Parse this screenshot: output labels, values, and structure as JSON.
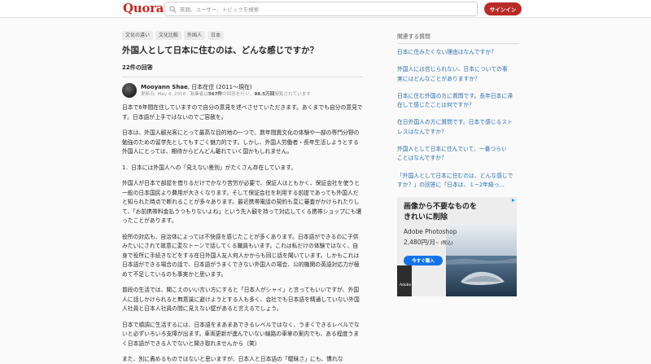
{
  "header": {
    "logo": "Quora",
    "search_placeholder": "質問、ユーザー、トピックを検索",
    "signin_label": "サインイン",
    "brand_color": "#b92b27"
  },
  "question": {
    "tags": [
      "文化の違い",
      "文化比較",
      "外国人",
      "日本"
    ],
    "title": "外国人として日本に住むのは、どんな感じですか？",
    "answer_count": "22件の回答"
  },
  "answer": {
    "author_name": "Mooyann Shae",
    "author_credential": ", 日本在住 (2011〜現在)",
    "meta_prefix": "更新日: May 4, 2018 · 執筆者は",
    "meta_answers": "567件",
    "meta_mid": "の回答を行い、",
    "meta_views": "98.5万回",
    "meta_suffix": "閲覧されています",
    "paragraphs": [
      "日本で6年間在住していますので自分の意見を述べさせていただきます。あくまでも自分の意見です。日本語が上手ではないのでご容赦を。",
      "日本は、外国人観光客にとって最高な目的地の一つで、数年間異文化の体験や一部の専門分野の勉強のための留学先としてもすごく魅力的です。しかし、外国人労働者・長年生活しようとする外国人にとっては、期待からどんどん離れていく国かもしれません。",
      "1．日本には外国人への「見えない差別」がたくさん存在しています。",
      "外国人が日本で部屋を借りるだけでかなり苦労が必要で、保証人はともかく、保証会社を使うと一般の日本国民より費用が大きくなります。そして保証会社を利用する前提であっても外国人だと知られた時点で断れることが多々あります。最近携帯電話の契約も変に審査がかけられたりして、「お前携帯料金払うつもりないよね」という先入観を持って対応してくる携帯ショップにも遭ったことがあります。",
      "役所の対応も、自治体によっては不快感を感じたことが多くあります。日本語ができるのに子供みたいにされて故意に変なトーンで話してくる職員もいます。これは私だけの体験ではなく、自身で役所に手続きなどをする在日外国人友人何人かからも同じ話を聞いています。しかもこれは日本語ができる場合の話で、日本語がうまくできない外国人の場合、公的機関の英語対応力が極めて不足しているのも事実かと思います。",
      "普段の生活では、聞こえのいい言い方にすると「日本人がシャイ」と言ってもいいですが、外国人に話しかけられると無意識に避けようとする人も多く、会社でも日本語を精通していない外国人社員と日本人社員の間に見えない壁があると言えるでしょう。",
      "日本で順調に生活するには、日本語をまあまあできるレベルではなく、うまくできるレベルでないと必ずいろいろ支障が出ます。車両更新が進んでいない線路の車掌の案内でも、ある程度うまく日本語ができる人でないと聞き取れませんから（笑）",
      "また、別に責めるものではないと思いますが、日本人と日本語の「曖昧さ」にも、慣れな"
    ]
  },
  "sidebar": {
    "title": "関連する質問",
    "link_color": "#2b6dad",
    "questions": [
      "日本に住みたくない理由はなんですか？",
      "外国人には信じられない、日本についての事\n実にはどんなことがありますか？",
      "日本に住む外国の方に質問です。長年日本に滞\n在して感じたことは何ですか？",
      "在日外国人の方に質問です。日本で感じるスト\nレスはなんですか？",
      "外国人として日本に住んでいて、一番つらい\nことはなんですか？",
      "「外国人として日本に住むのは、どんな感じで\nすか？」の回答に「日本は、１~2年経っ..."
    ]
  },
  "ad": {
    "headline": "画像から不要なものを\nきれいに削除",
    "product": "Adobe Photoshop",
    "price": "2,480円/月",
    "price_note": "~ (税込)",
    "cta": "今すぐ購入",
    "brand": "Adobe",
    "cta_color": "#1473e6"
  }
}
